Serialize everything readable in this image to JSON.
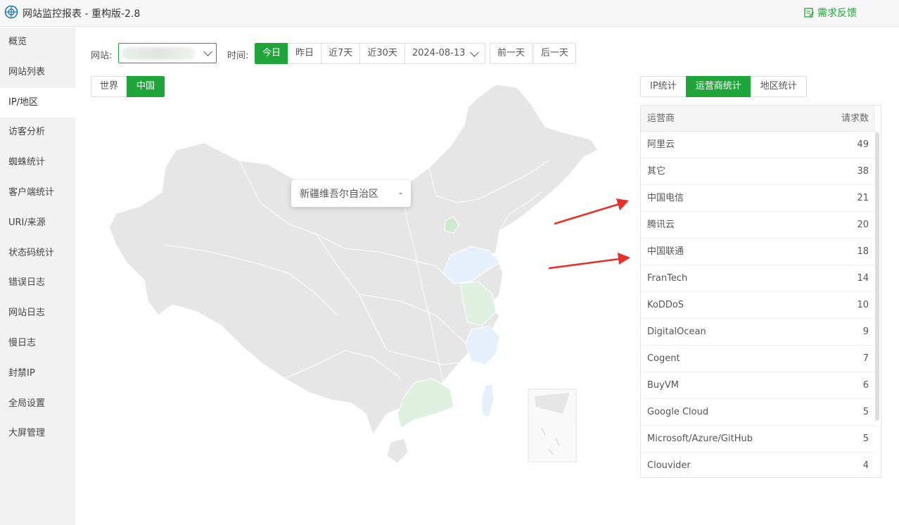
{
  "window": {
    "title": "网站监控报表 - 重构版-2.8",
    "feedback_label": "需求反馈"
  },
  "sidebar": {
    "items": [
      {
        "label": "概览"
      },
      {
        "label": "网站列表"
      },
      {
        "label": "IP/地区"
      },
      {
        "label": "访客分析"
      },
      {
        "label": "蜘蛛统计"
      },
      {
        "label": "客户端统计"
      },
      {
        "label": "URI/来源"
      },
      {
        "label": "状态码统计"
      },
      {
        "label": "错误日志"
      },
      {
        "label": "网站日志"
      },
      {
        "label": "慢日志"
      },
      {
        "label": "封禁IP"
      },
      {
        "label": "全局设置"
      },
      {
        "label": "大屏管理"
      }
    ],
    "active_index": 2
  },
  "filters": {
    "site_label": "网站:",
    "time_label": "时间:",
    "time_buttons": [
      "今日",
      "昨日",
      "近7天",
      "近30天"
    ],
    "date": "2024-08-13",
    "prev_day": "前一天",
    "next_day": "后一天"
  },
  "map_tabs": [
    "世界",
    "中国"
  ],
  "map": {
    "tooltip_region": "新疆维吾尔自治区",
    "tooltip_value": "-"
  },
  "stat_tabs": [
    "IP统计",
    "运营商统计",
    "地区统计"
  ],
  "table": {
    "headers": [
      "运营商",
      "请求数"
    ],
    "rows": [
      [
        "阿里云",
        "49"
      ],
      [
        "其它",
        "38"
      ],
      [
        "中国电信",
        "21"
      ],
      [
        "腾讯云",
        "20"
      ],
      [
        "中国联通",
        "18"
      ],
      [
        "FranTech",
        "14"
      ],
      [
        "KoDDoS",
        "10"
      ],
      [
        "DigitalOcean",
        "9"
      ],
      [
        "Cogent",
        "7"
      ],
      [
        "BuyVM",
        "6"
      ],
      [
        "Google Cloud",
        "5"
      ],
      [
        "Microsoft/Azure/GitHub",
        "5"
      ],
      [
        "Clouvider",
        "4"
      ]
    ]
  },
  "colors": {
    "accent": "#20a53a",
    "map_base": "#e6e6e6",
    "map_low": "#dff0e0",
    "map_blue": "#e6f0fb",
    "arrow": "#e8302a"
  }
}
